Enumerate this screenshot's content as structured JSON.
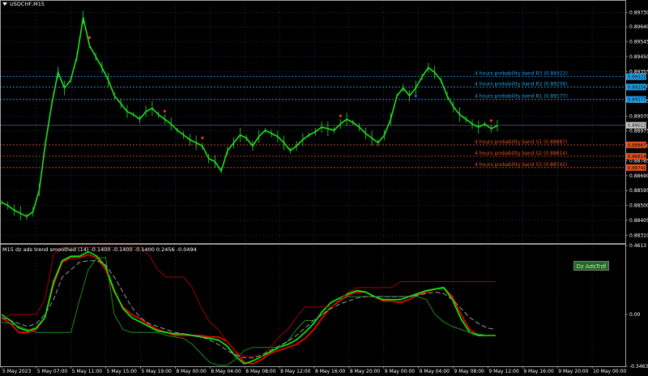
{
  "window": {
    "symbol": "USDCHF,M15"
  },
  "price_axis": {
    "labels": [
      "0.89730",
      "0.89640",
      "0.89545",
      "0.89450",
      "0.89355",
      "0.89260",
      "0.89165",
      "0.89070",
      "0.88975",
      "0.88880",
      "0.88785",
      "0.88690",
      "0.88595",
      "0.88500",
      "0.88405",
      "0.88310"
    ]
  },
  "price_tags": [
    {
      "text": "0.89322",
      "color": "#1ea0e8"
    },
    {
      "text": "0.89256",
      "color": "#1ea0e8"
    },
    {
      "text": "0.89177",
      "color": "#1ea0e8"
    },
    {
      "text": "0.89012",
      "color": "#c8c8c8"
    },
    {
      "text": "0.88887",
      "color": "#e8501e"
    },
    {
      "text": "0.88814",
      "color": "#e8501e"
    },
    {
      "text": "0.88742",
      "color": "#e8501e"
    }
  ],
  "bands": [
    {
      "label": "4 hours probability band R3 (0.89322)",
      "value": 0.89322,
      "color": "#1ea0e8"
    },
    {
      "label": "4 hours probability band R2 (0.89256)",
      "value": 0.89256,
      "color": "#1ea0e8"
    },
    {
      "label": "4 hours probability band R1 (0.89177)",
      "value": 0.89177,
      "color": "#1ea0e8"
    },
    {
      "label": "4 hours probability band S1 (0.88887)",
      "value": 0.88887,
      "color": "#e8501e"
    },
    {
      "label": "4 hours probability band S2 (0.88814)",
      "value": 0.88814,
      "color": "#e8501e"
    },
    {
      "label": "4 hours probability band S3 (0.88742)",
      "value": 0.88742,
      "color": "#e8501e"
    }
  ],
  "current_price": 0.89012,
  "indicator": {
    "title": "M15 dz ads trend smoothed (14) -0.1400 -0.1400 -0.1400 0.2456 -0.0494",
    "axis_labels": [
      "0.4613",
      "0.00",
      "-0.3463"
    ],
    "button_label": "Dz AdsTrdf"
  },
  "time_axis": {
    "labels": [
      "5 May 2023",
      "5 May 07:00",
      "5 May 11:00",
      "5 May 15:00",
      "5 May 19:00",
      "8 May 00:00",
      "8 May 04:00",
      "8 May 08:00",
      "8 May 12:00",
      "8 May 16:00",
      "8 May 20:00",
      "9 May 00:00",
      "9 May 04:00",
      "9 May 08:00",
      "9 May 12:00",
      "9 May 16:00",
      "9 May 20:00",
      "10 May 00:00"
    ]
  },
  "chart_data": {
    "type": "line",
    "title": "",
    "price_ylim": [
      0.8826,
      0.8977
    ],
    "close": [
      0.8852,
      0.885,
      0.8847,
      0.8845,
      0.8843,
      0.8846,
      0.886,
      0.889,
      0.8915,
      0.8935,
      0.8925,
      0.893,
      0.8945,
      0.897,
      0.8952,
      0.8945,
      0.8938,
      0.893,
      0.892,
      0.8915,
      0.891,
      0.8908,
      0.8905,
      0.891,
      0.8912,
      0.8908,
      0.8905,
      0.8902,
      0.8898,
      0.8895,
      0.8892,
      0.889,
      0.8888,
      0.888,
      0.8878,
      0.8872,
      0.8885,
      0.889,
      0.8895,
      0.8893,
      0.8888,
      0.8894,
      0.8898,
      0.8896,
      0.8894,
      0.889,
      0.8885,
      0.8888,
      0.8892,
      0.8895,
      0.8897,
      0.89,
      0.8899,
      0.8898,
      0.8902,
      0.8905,
      0.8903,
      0.89,
      0.8896,
      0.8893,
      0.889,
      0.8895,
      0.8905,
      0.892,
      0.8925,
      0.892,
      0.8925,
      0.8932,
      0.8938,
      0.8935,
      0.893,
      0.892,
      0.8913,
      0.8908,
      0.8905,
      0.8902,
      0.89,
      0.8902,
      0.8899,
      0.8901
    ],
    "signals": [
      {
        "index": 14,
        "color": "red"
      },
      {
        "index": 26,
        "color": "red"
      },
      {
        "index": 32,
        "color": "red"
      },
      {
        "index": 54,
        "color": "red"
      },
      {
        "index": 66,
        "color": "blue"
      },
      {
        "index": 78,
        "color": "red"
      }
    ],
    "indicator_ylim": [
      -0.3463,
      0.4613
    ],
    "series": [
      {
        "color": "#ff0000",
        "values": [
          -0.02,
          -0.06,
          -0.12,
          -0.12,
          -0.1,
          -0.02,
          0.2,
          0.35,
          0.38,
          0.38,
          0.4,
          0.38,
          0.3,
          0.15,
          0.05,
          0.0,
          -0.03,
          -0.07,
          -0.1,
          -0.12,
          -0.14,
          -0.14,
          -0.14,
          -0.14,
          -0.15,
          -0.15,
          -0.18,
          -0.25,
          -0.32,
          -0.33,
          -0.3,
          -0.26,
          -0.24,
          -0.22,
          -0.2,
          -0.16,
          -0.1,
          -0.02,
          0.05,
          0.09,
          0.13,
          0.15,
          0.15,
          0.12,
          0.09,
          0.09,
          0.08,
          0.1,
          0.13,
          0.15,
          0.17,
          0.18,
          0.12,
          0.0,
          -0.1,
          -0.14,
          -0.14,
          -0.14
        ]
      },
      {
        "color": "#00ff00",
        "values": [
          0.0,
          -0.04,
          -0.09,
          -0.11,
          -0.09,
          -0.02,
          0.22,
          0.36,
          0.39,
          0.39,
          0.42,
          0.39,
          0.32,
          0.16,
          0.04,
          -0.02,
          -0.05,
          -0.08,
          -0.11,
          -0.12,
          -0.13,
          -0.13,
          -0.14,
          -0.15,
          -0.16,
          -0.17,
          -0.21,
          -0.28,
          -0.33,
          -0.31,
          -0.28,
          -0.25,
          -0.22,
          -0.2,
          -0.17,
          -0.12,
          -0.06,
          0.02,
          0.08,
          0.11,
          0.14,
          0.16,
          0.15,
          0.12,
          0.1,
          0.1,
          0.1,
          0.12,
          0.14,
          0.16,
          0.17,
          0.18,
          0.1,
          -0.03,
          -0.12,
          -0.14,
          -0.14,
          -0.14
        ]
      },
      {
        "color": "#1c8c1c",
        "values": [
          -0.05,
          -0.06,
          -0.08,
          -0.1,
          -0.12,
          -0.12,
          -0.12,
          -0.12,
          -0.12,
          0.1,
          0.3,
          0.38,
          0.38,
          0.0,
          -0.1,
          -0.12,
          -0.12,
          -0.12,
          -0.12,
          -0.14,
          -0.15,
          -0.16,
          -0.2,
          -0.26,
          -0.32,
          -0.34,
          -0.34,
          -0.3,
          -0.24,
          -0.22,
          -0.22,
          -0.22,
          -0.22,
          -0.18,
          -0.1,
          -0.04,
          -0.04,
          0.0,
          0.05,
          0.1,
          0.12,
          0.12,
          0.12,
          0.12,
          0.12,
          0.12,
          0.12,
          0.12,
          0.12,
          0.1,
          0.0,
          -0.05,
          -0.08,
          -0.1,
          -0.12,
          -0.13,
          -0.14,
          -0.14
        ]
      },
      {
        "color": "#a00000",
        "values": [
          -0.04,
          0.0,
          0.0,
          0.0,
          0.0,
          0.1,
          0.4,
          0.45,
          0.45,
          0.45,
          0.45,
          0.45,
          0.45,
          0.45,
          0.45,
          0.45,
          0.45,
          0.4,
          0.3,
          0.25,
          0.25,
          0.25,
          0.18,
          0.05,
          -0.05,
          -0.1,
          -0.18,
          -0.25,
          -0.28,
          -0.28,
          -0.28,
          -0.22,
          -0.15,
          -0.1,
          -0.02,
          0.05,
          0.05,
          0.05,
          0.05,
          0.1,
          0.15,
          0.18,
          0.18,
          0.18,
          0.18,
          0.18,
          0.22,
          0.22,
          0.22,
          0.22,
          0.22,
          0.22,
          0.22,
          0.22,
          0.22,
          0.22,
          0.22,
          0.22
        ]
      },
      {
        "color": "#9a9a9a",
        "dashed": true,
        "values": [
          -0.02,
          -0.04,
          -0.06,
          -0.08,
          -0.06,
          0.0,
          0.1,
          0.25,
          0.3,
          0.35,
          0.36,
          0.36,
          0.33,
          0.25,
          0.15,
          0.05,
          -0.02,
          -0.06,
          -0.08,
          -0.1,
          -0.12,
          -0.13,
          -0.14,
          -0.15,
          -0.17,
          -0.2,
          -0.24,
          -0.27,
          -0.29,
          -0.29,
          -0.27,
          -0.24,
          -0.21,
          -0.18,
          -0.14,
          -0.09,
          -0.04,
          0.0,
          0.04,
          0.07,
          0.09,
          0.11,
          0.12,
          0.12,
          0.12,
          0.12,
          0.12,
          0.12,
          0.13,
          0.14,
          0.15,
          0.14,
          0.1,
          0.04,
          -0.02,
          -0.06,
          -0.09,
          -0.1
        ]
      }
    ]
  }
}
